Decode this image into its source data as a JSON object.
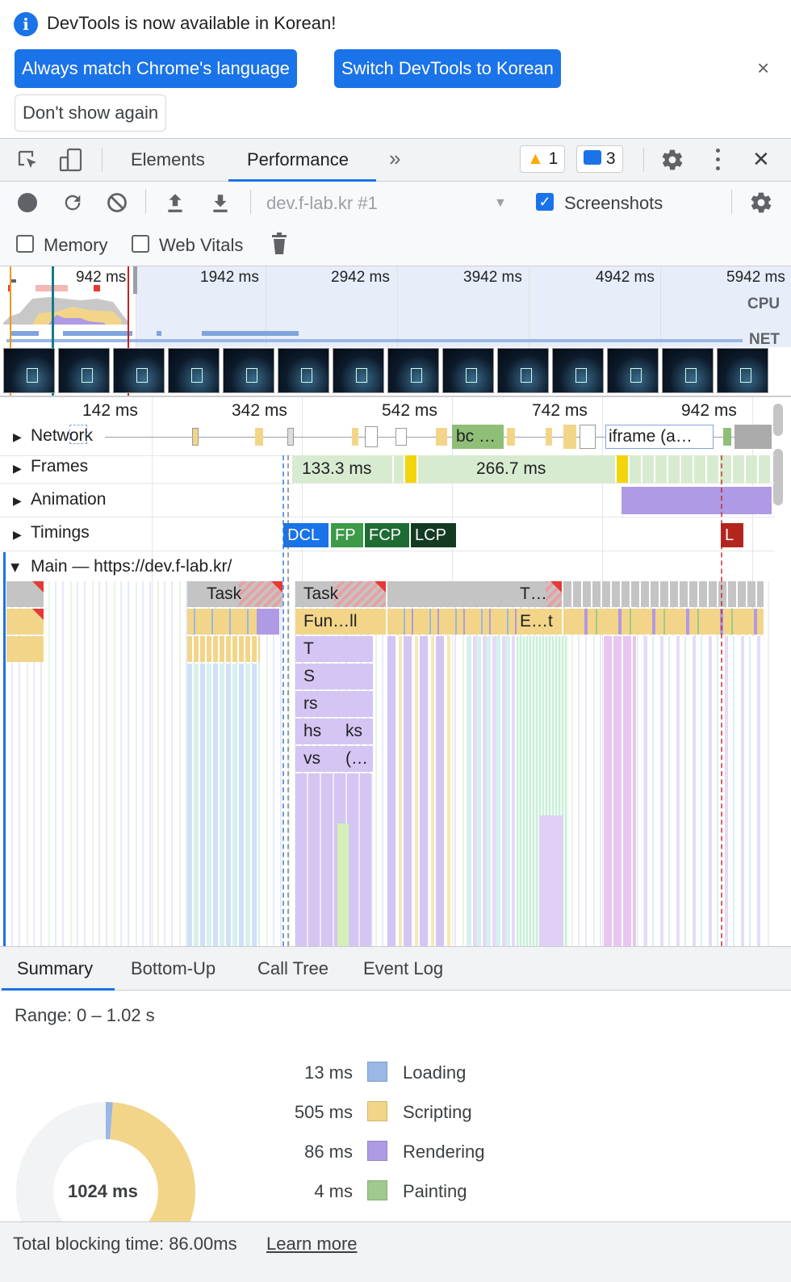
{
  "infobar": {
    "message": "DevTools is now available in Korean!",
    "btn_match": "Always match Chrome's language",
    "btn_switch": "Switch DevTools to Korean",
    "btn_dont_show": "Don't show again",
    "info_glyph": "i",
    "close_glyph": "×"
  },
  "tabbar": {
    "tab_elements": "Elements",
    "tab_performance": "Performance",
    "more_tabs": "»",
    "warnings_count": "1",
    "messages_count": "3",
    "close_glyph": "✕"
  },
  "perf_toolbar": {
    "recording_target": "dev.f-lab.kr #1",
    "screenshots_label": "Screenshots",
    "screenshots_checked": true,
    "memory_label": "Memory",
    "web_vitals_label": "Web Vitals"
  },
  "overview": {
    "ticks": [
      "942 ms",
      "1942 ms",
      "2942 ms",
      "3942 ms",
      "4942 ms",
      "5942 ms"
    ],
    "cpu_label": "CPU",
    "net_label": "NET"
  },
  "flame": {
    "ruler_ticks": [
      "142 ms",
      "342 ms",
      "542 ms",
      "742 ms",
      "942 ms"
    ],
    "tracks": {
      "network": "Network",
      "frames": "Frames",
      "animation": "Animation",
      "timings": "Timings",
      "main": "Main — https://dev.f-lab.kr/"
    },
    "network_labels": [
      "bc …",
      "iframe (a…"
    ],
    "frame_labels": [
      "133.3 ms",
      "266.7 ms"
    ],
    "timings": [
      "DCL",
      "FP",
      "FCP",
      "LCP",
      "L"
    ],
    "flame_labels": {
      "task1": "Task",
      "task2": "Task",
      "task3": "T…",
      "fun": "Fun…ll",
      "et": "E…t",
      "t": "T",
      "s": "S",
      "rs": "rs",
      "hs": "hs",
      "ks": "ks",
      "vs": "vs",
      "paren": "(…"
    }
  },
  "bottom": {
    "tabs": [
      "Summary",
      "Bottom-Up",
      "Call Tree",
      "Event Log"
    ],
    "range": "Range: 0 – 1.02 s",
    "total": "1024 ms",
    "rows": [
      {
        "value": "13 ms",
        "label": "Loading",
        "color": "#9ab7e5"
      },
      {
        "value": "505 ms",
        "label": "Scripting",
        "color": "#f2d588"
      },
      {
        "value": "86 ms",
        "label": "Rendering",
        "color": "#af9ae5"
      },
      {
        "value": "4 ms",
        "label": "Painting",
        "color": "#9fc98d"
      }
    ],
    "footer_text": "Total blocking time: 86.00ms",
    "learn_more": "Learn more"
  },
  "colors": {
    "accent": "#1a73e8",
    "scripting": "#f2d588",
    "rendering": "#af9ae5",
    "painting": "#9fc98d",
    "loading": "#9ab7e5"
  }
}
